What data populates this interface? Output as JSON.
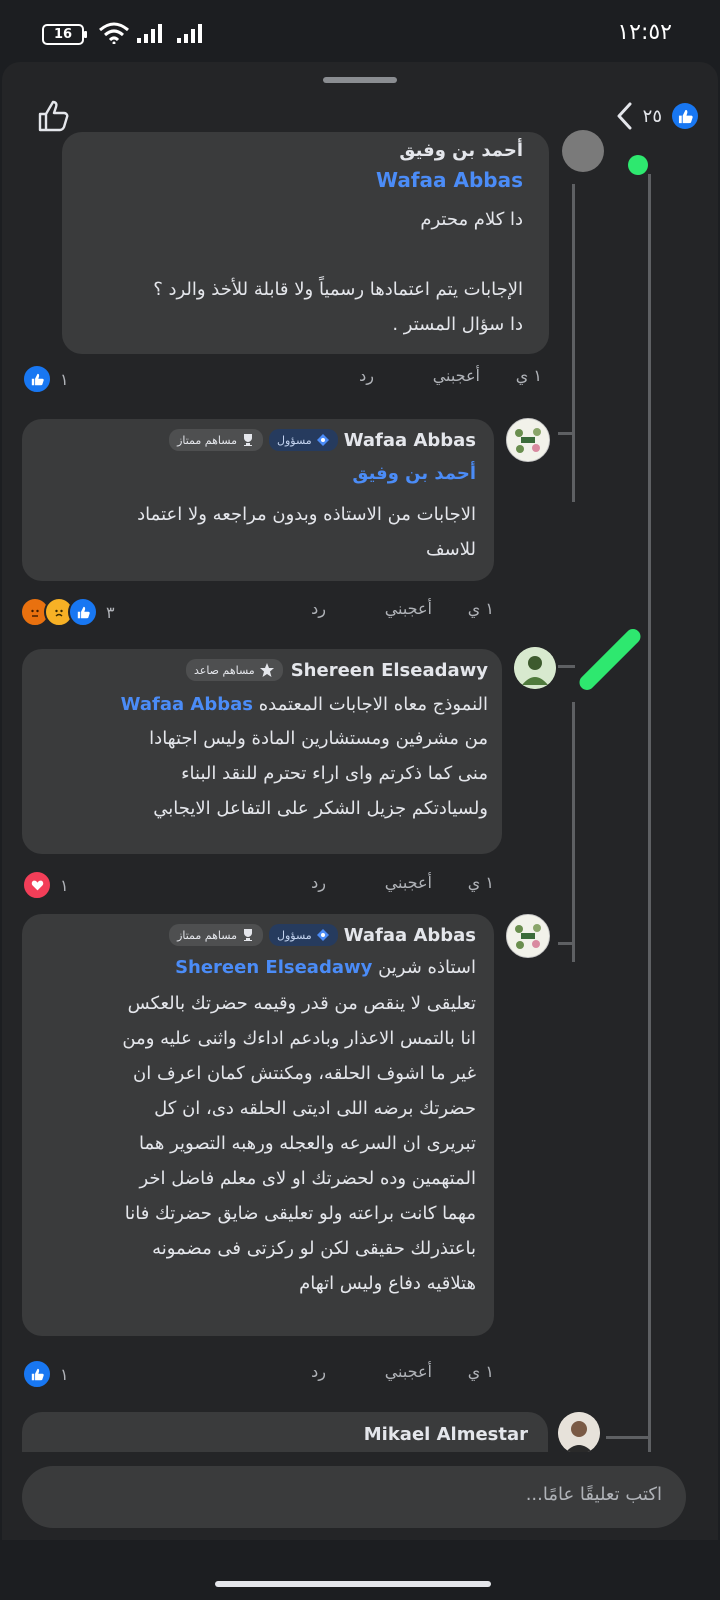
{
  "status_bar": {
    "time": "١٢:٥٢",
    "battery": "16"
  },
  "header": {
    "reaction_count": "٢٥"
  },
  "comments": [
    {
      "author_partial": "أحمد بن وفيق",
      "mention": "Wafaa Abbas",
      "text": "دا كلام محترم\n\nالإجابات يتم اعتمادها رسمياً ولا قابلة للأخذ والرد ؟\nدا سؤال المستر .",
      "time": "١ ي",
      "like": "أعجبني",
      "reply": "رد",
      "reaction_count": "١"
    },
    {
      "author": "Wafaa Abbas",
      "badge_role": "مسؤول",
      "badge_top": "مساهم ممتاز",
      "mention": "أحمد بن وفيق",
      "text": "الاجابات من الاستاذه وبدون مراجعه ولا اعتماد\nللاسف",
      "time": "١ ي",
      "like": "أعجبني",
      "reply": "رد",
      "reaction_count": "٣"
    },
    {
      "author": "Shereen Elseadawy",
      "badge": "مساهم صاعد",
      "mention": "Wafaa Abbas",
      "text_first": "النموذج معاه الاجابات المعتمده",
      "text": "من مشرفين ومستشارين المادة وليس اجتهادا\nمنى كما ذكرتم واى اراء تحترم للنقد البناء\nولسيادتكم جزيل الشكر على التفاعل الايجابي",
      "time": "١ ي",
      "like": "أعجبني",
      "reply": "رد",
      "reaction_count": "١"
    },
    {
      "author": "Wafaa Abbas",
      "badge_role": "مسؤول",
      "badge_top": "مساهم ممتاز",
      "mention": "Shereen Elseadawy",
      "text_first": "استاذه شرين",
      "text": "تعليقى لا ينقص من قدر وقيمه حضرتك بالعكس\nانا بالتمس الاعذار وبادعم اداءك واثنى عليه ومن\nغير ما اشوف الحلقه، ومكنتش كمان اعرف ان\nحضرتك برضه اللى اديتى الحلقه دى، ان كل\nتبريرى ان السرعه والعجله ورهبه التصوير هما\nالمتهمين وده لحضرتك او لاى معلم فاضل اخر\nمهما كانت براعته ولو تعليقى ضايق حضرتك فانا\nباعتذرلك حقيقى لكن لو ركزتى فى مضمونه\nهتلاقيه دفاع وليس اتهام",
      "time": "١ ي",
      "like": "أعجبني",
      "reply": "رد",
      "reaction_count": "١"
    },
    {
      "author": "Mikael Almestar"
    }
  ],
  "composer": {
    "placeholder": "اكتب تعليقًا عامًا..."
  },
  "colors": {
    "background": "#242527",
    "bubble": "#3a3b3c",
    "mention": "#4b8cf7",
    "like_blue": "#1877f2",
    "love_red": "#f33e58",
    "highlight_green": "#2ee86f"
  }
}
